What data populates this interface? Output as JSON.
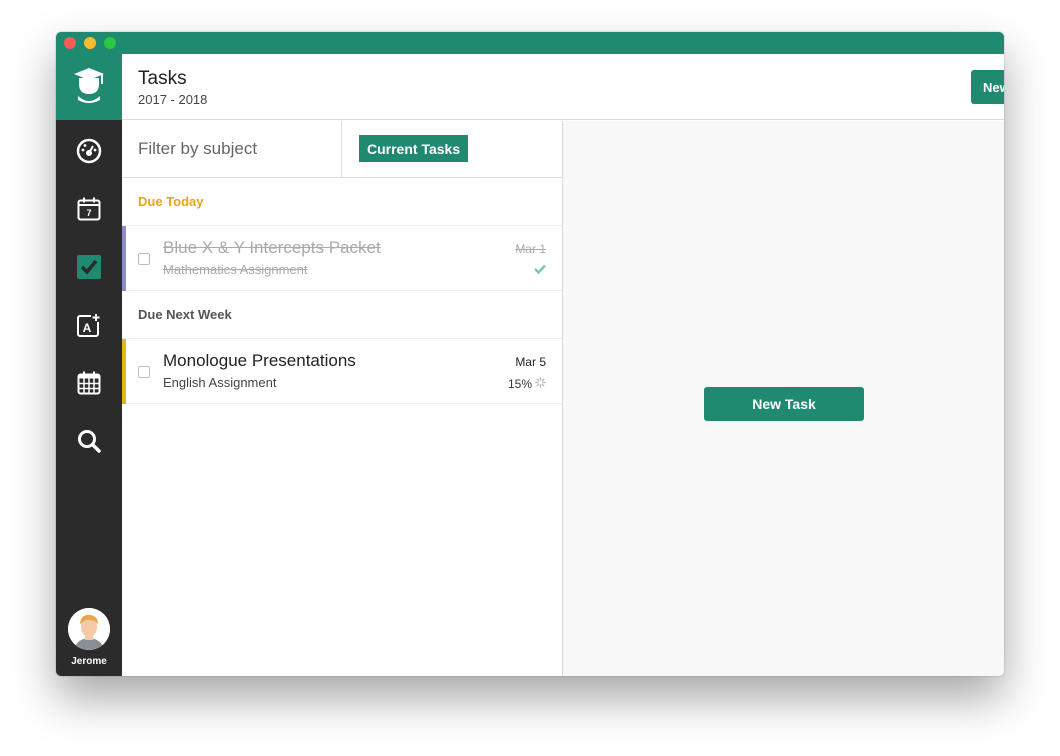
{
  "colors": {
    "brand": "#1f8a70",
    "sidebar": "#2b2b2b",
    "due_today": "#e8a317",
    "due_next_week": "#555555"
  },
  "header": {
    "title": "Tasks",
    "subtitle": "2017 - 2018",
    "new_task_label": "New Task"
  },
  "sidebar": {
    "logo_icon": "graduation-cap-icon",
    "items": [
      {
        "icon": "dashboard-icon"
      },
      {
        "icon": "calendar-day-icon",
        "badge": "7"
      },
      {
        "icon": "tasks-check-icon",
        "active": true
      },
      {
        "icon": "add-subject-icon",
        "badge": "A"
      },
      {
        "icon": "schedule-grid-icon"
      },
      {
        "icon": "search-icon"
      }
    ],
    "user_name": "Jerome"
  },
  "filters": {
    "subject_placeholder": "Filter by subject",
    "current_tab": "Current Tasks"
  },
  "sections": [
    {
      "title": "Due Today",
      "tasks": [
        {
          "title": "Blue X & Y Intercepts Packet",
          "subtitle": "Mathematics Assignment",
          "date": "Mar 1",
          "status": "done",
          "bar_color": "#8e8cc7"
        }
      ]
    },
    {
      "title": "Due Next Week",
      "tasks": [
        {
          "title": "Monologue Presentations",
          "subtitle": "English Assignment",
          "date": "Mar 5",
          "progress": "15%",
          "bar_color": "#e0b910"
        }
      ]
    }
  ],
  "detail": {
    "new_task_label": "New Task"
  }
}
